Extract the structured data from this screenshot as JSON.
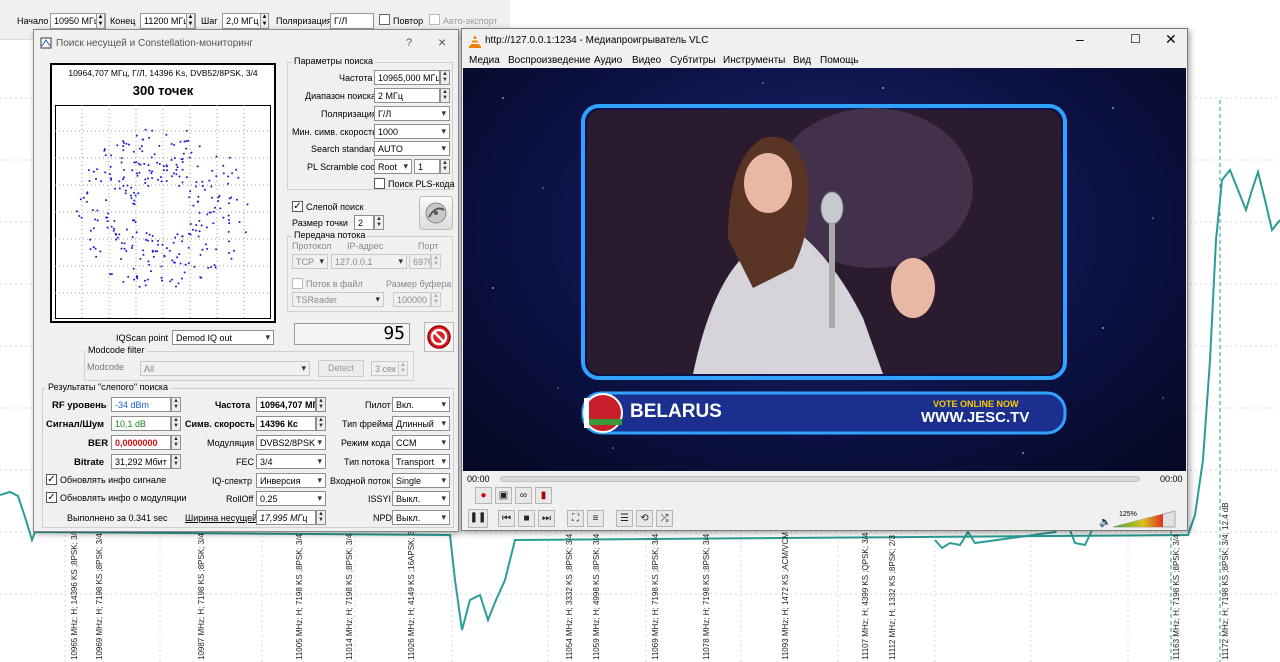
{
  "toolbar": {
    "start_label": "Начало",
    "start_value": "10950 МГц",
    "end_label": "Конец",
    "end_value": "11200 МГц",
    "step_label": "Шаг",
    "step_value": "2,0 МГц",
    "pol_label": "Поляризация",
    "pol_value": "Г/Л",
    "repeat_label": "Повтор",
    "autoexport_label": "Авто-экспорт"
  },
  "chart": {
    "line_color": "#2a9d96",
    "labels": [
      "10965 MHz; H; 14396 KS ;8PSK; 3/4",
      "10969 MHz; H; 7198 KS ;8PSK; 3/4",
      "10987 MHz; H; 7198 KS ;8PSK; 3/4",
      "11005 MHz; H; 7198 KS ;8PSK; 3/4",
      "11014 MHz; H; 7198 KS ;8PSK; 3/4",
      "11026 MHz; H; 4149 KS ;16APSK; 3/4",
      "11054 MHz; H; 3332 KS ;8PSK; 3/4",
      "11059 MHz; H; 4998 KS ;8PSK; 3/4",
      "11069 MHz; H; 7198 KS ;8PSK; 3/4",
      "11078 MHz; H; 7198 KS ;8PSK; 3/4",
      "11093 MHz; H; 1472 KS ;ACM/VCM",
      "11107 MHz; H; 4399 KS ;QPSK; 3/4",
      "11112 MHz; H; 1332 KS ;8PSK; 2/3",
      "11163 MHz; H; 7198 KS ;8PSK; 3/4",
      "11172 MHz; H; 7198 KS ;8PSK; 3/4; 12.4 dB"
    ]
  },
  "dialog": {
    "title": "Поиск несущей и Constellation-мониторинг",
    "help": "?",
    "close": "×",
    "constellation": {
      "header": "10964,707 МГц, Г/Л, 14396 Ks, DVB52/8PSK, 3/4",
      "points_label": "300 точек"
    },
    "params_group": "Параметры поиска",
    "freq_label": "Частота",
    "freq_value": "10965,000 МГц",
    "range_label": "Диапазон поиска",
    "range_value": "2 МГц",
    "pol_label": "Поляризация",
    "pol_value": "Г/Л",
    "minsr_label": "Мин. симв. скорость",
    "minsr_value": "1000",
    "std_label": "Search standard",
    "std_value": "AUTO",
    "plscr_label": "PL Scramble code",
    "plscr_value": "Root",
    "plscr_num": "1",
    "pls_search_label": "Поиск PLS-кода",
    "blind_label": "Слепой поиск",
    "dotsize_label": "Размер точки",
    "dotsize_value": "2",
    "stream_group": "Передача потока",
    "proto_label": "Протокол",
    "ip_label": "IP-адрес",
    "port_label": "Порт",
    "proto_value": "TCP",
    "ip_value": "127.0.0.1",
    "port_value": "6970",
    "tofile_label": "Поток в файл",
    "bufsize_label": "Размер буфера",
    "reader_value": "TSReader",
    "bufsize_value": "100000",
    "counter": "95",
    "iqscan_label": "IQScan point",
    "iqscan_value": "Demod IQ out",
    "modcode_group": "Modcode filter",
    "modcode_label": "Modcode",
    "modcode_value": "All",
    "detect_label": "Detect",
    "detect_time": "3 сек",
    "results_group": "Результаты \"слепого\" поиска",
    "rf_label": "RF уровень",
    "rf_value": "-34 dBm",
    "snr_label": "Сигнал/Шум",
    "snr_value": "10,1 dB",
    "ber_label": "BER",
    "ber_value": "0,0000000",
    "bitrate_label": "Bitrate",
    "bitrate_value": "31,292 Мбит",
    "r_freq_label": "Частота",
    "r_freq_value": "10964,707 МГц",
    "r_sr_label": "Симв. скорость",
    "r_sr_value": "14396 Кс",
    "mod_label": "Модуляция",
    "mod_value": "DVBS2/8PSK",
    "fec_label": "FEC",
    "fec_value": "3/4",
    "iq_label": "IQ-спектр",
    "iq_value": "Инверсия",
    "rolloff_label": "RollOff",
    "rolloff_value": "0.25",
    "bw_label": "Ширина несущей",
    "bw_value": "17,995 МГц",
    "pilot_label": "Пилот",
    "pilot_value": "Вкл.",
    "frame_label": "Тип фрейма",
    "frame_value": "Длинный",
    "codemode_label": "Режим кода",
    "codemode_value": "CCM",
    "stream_type_label": "Тип потока",
    "stream_type_value": "Transport",
    "input_label": "Входной поток",
    "input_value": "Single",
    "issyi_label": "ISSYI",
    "issyi_value": "Выкл.",
    "npd_label": "NPD",
    "npd_value": "Выкл.",
    "upd_signal_label": "Обновлять инфо сигнале",
    "upd_mod_label": "Обновлять инфо о модуляции",
    "done_label": "Выполнено за 0.341 sec"
  },
  "vlc": {
    "title": "http://127.0.0.1:1234 - Медиапроигрыватель VLC",
    "menu": [
      "Медиа",
      "Воспроизведение",
      "Аудио",
      "Видео",
      "Субтитры",
      "Инструменты",
      "Вид",
      "Помощь"
    ],
    "country": "BELARUS",
    "vote": "VOTE ONLINE NOW",
    "site": "WWW.JESC.TV",
    "time_left": "00:00",
    "time_right": "00:00",
    "volume": "125%"
  }
}
